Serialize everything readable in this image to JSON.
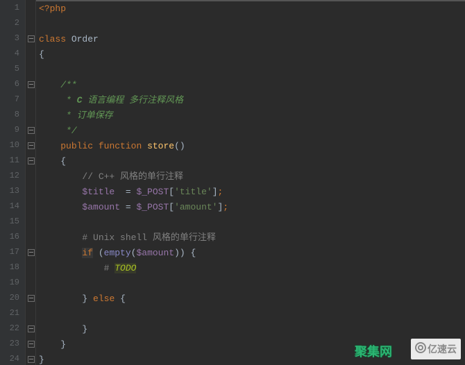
{
  "lineNumbers": [
    "1",
    "2",
    "3",
    "4",
    "5",
    "6",
    "7",
    "8",
    "9",
    "10",
    "11",
    "12",
    "13",
    "14",
    "15",
    "16",
    "17",
    "18",
    "19",
    "20",
    "21",
    "22",
    "23",
    "24"
  ],
  "code": {
    "php_open": "<?php",
    "kw_class": "class",
    "class_name": "Order",
    "brace_open": "{",
    "brace_close": "}",
    "doc_start": "/**",
    "doc_line1_star": " *",
    "doc_line1_c": " C",
    "doc_line1_text": " 语言编程 多行注释风格",
    "doc_line2": " * 订单保存",
    "doc_end": " */",
    "kw_public": "public",
    "kw_function": "function",
    "func_store": "store",
    "parens_empty": "()",
    "cpp_comment": "// C++ 风格的单行注释",
    "var_title": "$title",
    "var_amount": "$amount",
    "assign": " = ",
    "assign_sp": "  = ",
    "superglobal": "$_POST",
    "bracket_open": "[",
    "bracket_close": "]",
    "str_title": "'title'",
    "str_amount": "'amount'",
    "semicolon": ";",
    "unix_comment": "# Unix shell 风格的单行注释",
    "kw_if": "if",
    "builtin_empty": "empty",
    "paren_open": "(",
    "paren_close": ")",
    "sp_paren_open": " (",
    "dbl_paren_close": "))",
    "sp_brace_open": " {",
    "todo_hash": "# ",
    "todo_tag": "TODO",
    "kw_close_brace": "}",
    "kw_else": "else"
  },
  "watermarks": {
    "wm1": "聚集网",
    "wm2": "亿速云"
  },
  "foldMarkers": [
    3,
    6,
    9,
    10,
    11,
    17,
    20,
    22,
    23,
    24
  ]
}
